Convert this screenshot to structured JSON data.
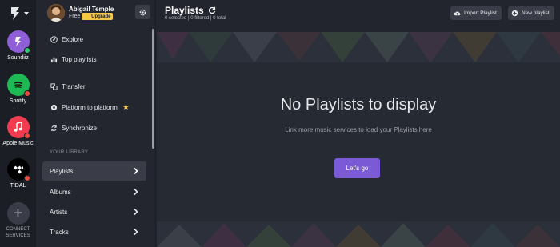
{
  "rail": {
    "services": [
      {
        "label": "Soundiiz",
        "icon": "soundiiz-icon",
        "color": "#8e5fd6",
        "status": "#2ecc71"
      },
      {
        "label": "Spotify",
        "icon": "spotify-icon",
        "color": "#1db954",
        "status": "#e74c3c"
      },
      {
        "label": "Apple Music",
        "icon": "apple-music-icon",
        "color": "#f23b4f",
        "status": "#e74c3c"
      },
      {
        "label": "TIDAL",
        "icon": "tidal-icon",
        "color": "#000000",
        "status": "#e74c3c"
      }
    ],
    "connect_label_1": "CONNECT",
    "connect_label_2": "SERVICES"
  },
  "user": {
    "name": "Abigail Temple",
    "plan": "Free",
    "upgrade_label": "⚡ Upgrade"
  },
  "sidebar": {
    "items": [
      {
        "label": "Explore",
        "icon": "compass-icon"
      },
      {
        "label": "Top playlists",
        "icon": "chart-icon"
      },
      {
        "label": "Transfer",
        "icon": "transfer-icon"
      },
      {
        "label": "Platform to platform",
        "icon": "sync-platform-icon"
      },
      {
        "label": "Synchronize",
        "icon": "synchronize-icon"
      }
    ],
    "library_title": "YOUR LIBRARY",
    "library": [
      {
        "label": "Playlists",
        "active": true
      },
      {
        "label": "Albums",
        "active": false
      },
      {
        "label": "Artists",
        "active": false
      },
      {
        "label": "Tracks",
        "active": false
      }
    ]
  },
  "header": {
    "title": "Playlists",
    "counts": "0 selected | 0 filtered | 0 total",
    "import_label": "Import Playlist",
    "new_label": "New playlist"
  },
  "empty": {
    "title": "No Playlists to display",
    "subtitle": "Link more music services to load your Playlists here",
    "cta": "Let's go"
  },
  "colors": {
    "accent": "#7b5ad6",
    "upgrade": "#f2c94c",
    "background": "#262a33"
  }
}
